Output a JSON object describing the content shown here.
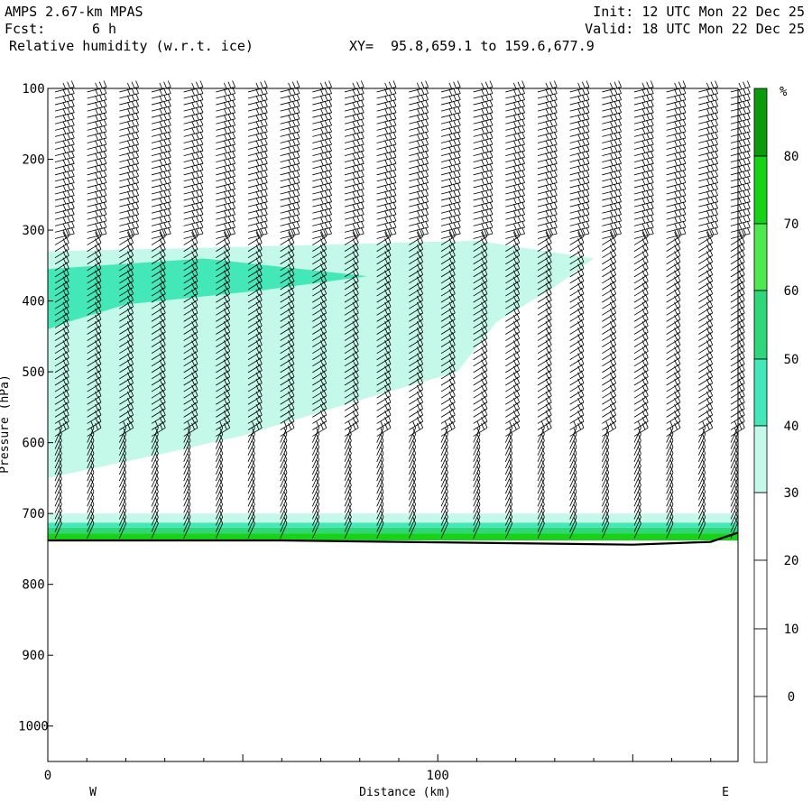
{
  "header": {
    "model": "AMPS 2.67-km MPAS",
    "fcst_label": "Fcst:",
    "fcst_value": "6 h",
    "field": "Relative humidity (w.r.t. ice)",
    "xy_label": "XY=",
    "xy_value": "95.8,659.1 to 159.6,677.9",
    "init": "Init: 12 UTC Mon 22 Dec 25",
    "valid": "Valid: 18 UTC Mon 22 Dec 25"
  },
  "colorbar": {
    "unit": "%",
    "levels": [
      {
        "label": "80",
        "color": "#0d9a0d"
      },
      {
        "label": "70",
        "color": "#18d218"
      },
      {
        "label": "60",
        "color": "#50e850"
      },
      {
        "label": "50",
        "color": "#2fd67a"
      },
      {
        "label": "40",
        "color": "#44e8b8"
      },
      {
        "label": "30",
        "color": "#c4f8e8"
      },
      {
        "label": "20",
        "color": "#ffffff"
      },
      {
        "label": "10",
        "color": "#ffffff"
      },
      {
        "label": "0",
        "color": "#ffffff"
      }
    ]
  },
  "chart_data": {
    "type": "heatmap",
    "title": "Relative humidity (w.r.t. ice)",
    "xlabel": "Distance (km)",
    "ylabel": "Pressure (hPa)",
    "xlim": [
      0,
      177
    ],
    "ylim": [
      1050,
      100
    ],
    "x_ticks": [
      "0",
      "100"
    ],
    "y_ticks": [
      "100",
      "200",
      "300",
      "400",
      "500",
      "600",
      "700",
      "800",
      "900",
      "1000"
    ],
    "x_end_labels": {
      "left": "W",
      "right": "E"
    },
    "levels_percent": [
      0,
      10,
      20,
      30,
      40,
      50,
      60,
      70,
      80
    ],
    "regions": [
      {
        "level": "30-40",
        "description_points_km_hpa": [
          [
            0,
            330
          ],
          [
            40,
            325
          ],
          [
            110,
            315
          ],
          [
            140,
            340
          ],
          [
            130,
            380
          ],
          [
            115,
            430
          ],
          [
            105,
            500
          ],
          [
            80,
            540
          ],
          [
            50,
            590
          ],
          [
            30,
            615
          ],
          [
            0,
            650
          ]
        ]
      },
      {
        "level": "40-50",
        "description_points_km_hpa": [
          [
            0,
            355
          ],
          [
            40,
            340
          ],
          [
            82,
            365
          ],
          [
            55,
            385
          ],
          [
            20,
            405
          ],
          [
            5,
            430
          ],
          [
            0,
            440
          ]
        ]
      },
      {
        "level": "30-80 surface band",
        "description_points_km_hpa": [
          [
            0,
            700
          ],
          [
            177,
            710
          ],
          [
            177,
            735
          ],
          [
            0,
            735
          ]
        ]
      }
    ],
    "terrain_hpa": [
      [
        0,
        738
      ],
      [
        30,
        738
      ],
      [
        60,
        738
      ],
      [
        90,
        740
      ],
      [
        120,
        742
      ],
      [
        150,
        744
      ],
      [
        170,
        740
      ],
      [
        177,
        727
      ]
    ],
    "wind_barbs": "present on every sampled column, 100 hPa to the surface"
  }
}
